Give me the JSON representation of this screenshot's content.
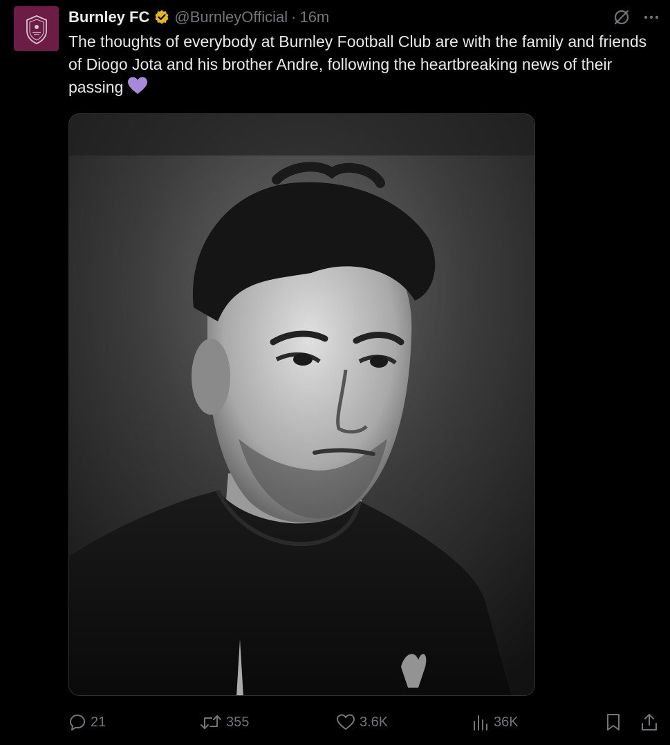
{
  "tweet": {
    "author_name": "Burnley FC",
    "handle": "@BurnleyOfficial",
    "separator": "·",
    "time": "16m",
    "text": "The thoughts of everybody at Burnley Football Club are with the family and friends of Diogo Jota and his brother Andre, following the heartbreaking news of their passing",
    "emoji": "purple-heart"
  },
  "media": {
    "description_icon": "photo-monochrome-portrait"
  },
  "actions": {
    "replies": "21",
    "reposts": "355",
    "likes": "3.6K",
    "views": "36K"
  },
  "colors": {
    "background": "#000000",
    "text": "#e7e9ea",
    "muted": "#71767b",
    "avatar_bg": "#6c1d45",
    "verified_badge": "#e2b719",
    "emoji_heart": "#a78bda"
  }
}
